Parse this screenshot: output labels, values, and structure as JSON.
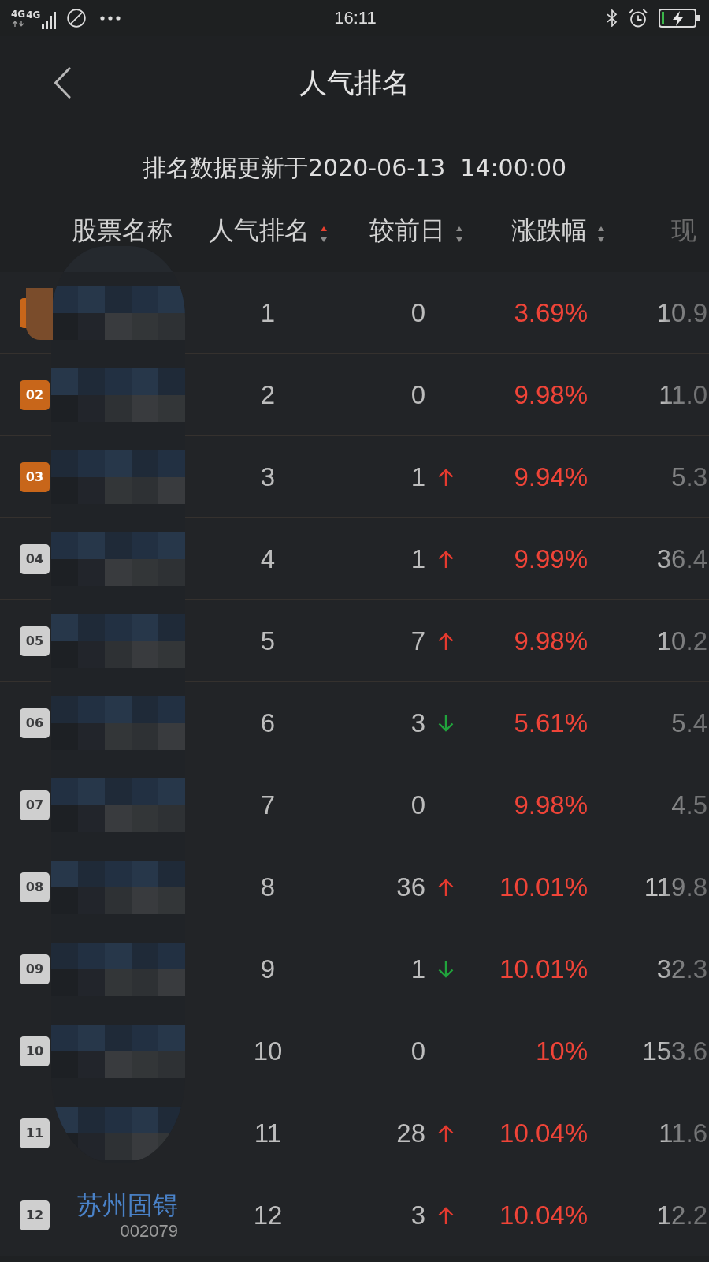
{
  "status_bar": {
    "network_labels": [
      "4G",
      "4G"
    ],
    "time": "16:11"
  },
  "nav_bar": {
    "title": "人气排名"
  },
  "update_notice": "排名数据更新于2020-06-13  14:00:00",
  "table": {
    "columns": [
      {
        "label": "股票名称"
      },
      {
        "label": "人气排名",
        "sorted": true
      },
      {
        "label": "较前日",
        "sorted": false
      },
      {
        "label": "涨跌幅",
        "sorted": false
      },
      {
        "label": "现"
      }
    ],
    "rows": [
      {
        "badge": {
          "color": "#c8661a"
        },
        "rank": "1",
        "change": "0",
        "rising": false,
        "falling": false,
        "pct": "3.69%",
        "price": "10.9"
      },
      {
        "badge": {
          "label": "02",
          "color": "#c8661a"
        },
        "rank": "2",
        "change": "0",
        "rising": false,
        "falling": false,
        "pct": "9.98%",
        "price": "11.0"
      },
      {
        "badge": {
          "label": "03",
          "color": "#c8661a"
        },
        "rank": "3",
        "change": "1",
        "rising": true,
        "falling": false,
        "pct": "9.94%",
        "price": "5.3"
      },
      {
        "badge": {
          "label": "04",
          "color": "#cfcfcf"
        },
        "rank": "4",
        "change": "1",
        "rising": true,
        "falling": false,
        "pct": "9.99%",
        "price": "36.4"
      },
      {
        "badge": {
          "label": "05",
          "color": "#cfcfcf"
        },
        "rank": "5",
        "change": "7",
        "rising": true,
        "falling": false,
        "pct": "9.98%",
        "price": "10.2"
      },
      {
        "badge": {
          "label": "06",
          "color": "#cfcfcf"
        },
        "rank": "6",
        "change": "3",
        "rising": false,
        "falling": true,
        "pct": "5.61%",
        "price": "5.4"
      },
      {
        "badge": {
          "label": "07",
          "color": "#cfcfcf"
        },
        "rank": "7",
        "change": "0",
        "rising": false,
        "falling": false,
        "pct": "9.98%",
        "price": "4.5"
      },
      {
        "badge": {
          "label": "08",
          "color": "#cfcfcf"
        },
        "rank": "8",
        "change": "36",
        "rising": true,
        "falling": false,
        "pct": "10.01%",
        "price": "119.8"
      },
      {
        "badge": {
          "label": "09",
          "color": "#cfcfcf"
        },
        "rank": "9",
        "change": "1",
        "rising": false,
        "falling": true,
        "pct": "10.01%",
        "price": "32.3"
      },
      {
        "badge": {
          "label": "10",
          "color": "#cfcfcf"
        },
        "rank": "10",
        "change": "0",
        "rising": false,
        "falling": false,
        "pct": "10%",
        "price": "153.6"
      },
      {
        "badge": {
          "label": "11",
          "color": "#cfcfcf"
        },
        "rank": "11",
        "change": "28",
        "rising": true,
        "falling": false,
        "pct": "10.04%",
        "price": "11.6"
      },
      {
        "badge": {
          "label": "12",
          "color": "#cfcfcf"
        },
        "name": "苏州固锝",
        "code": "002079",
        "rank": "12",
        "change": "3",
        "rising": true,
        "falling": false,
        "pct": "10.04%",
        "price": "12.2"
      }
    ]
  }
}
